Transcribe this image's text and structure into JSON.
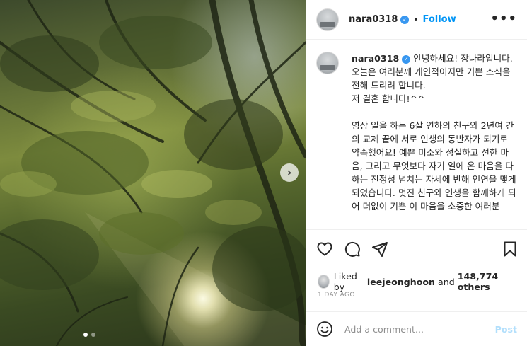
{
  "post": {
    "author": "nara0318",
    "follow_label": "Follow",
    "separator": "•",
    "more_label": "•••",
    "caption": {
      "username": "nara0318",
      "paragraph1": "안녕하세요! 장나라입니다.\n오늘은 여러분께 개인적이지만 기쁜 소식을 전해 드리려 합니다.\n저 결혼 합니다!^^",
      "paragraph2": "영상 일을 하는 6살 연하의 친구와 2년여 간의 교제 끝에 서로 인생의 동반자가 되기로 약속했어요! 예쁜 미소와 성실하고 선한 마음, 그리고 무엇보다 자기 일에 온 마음을 다하는 진정성 넘치는 자세에 반해 인연을 맺게 되었습니다. 멋진 친구와 인생을 함께하게 되어 더없이 기쁜 이 마음을 소중한 여러분"
    },
    "likes": {
      "prefix": "Liked by",
      "liked_by_user": "leejeonghoon",
      "and_label": "and",
      "others_label": "148,774 others"
    },
    "timestamp": "1 day ago",
    "comment": {
      "placeholder": "Add a comment...",
      "post_label": "Post"
    }
  },
  "media": {
    "next_arrow": "›",
    "carousel_dots": 2,
    "active_dot": 0
  },
  "icons": {
    "verified": "verified-badge-icon",
    "like": "heart-icon",
    "comment": "comment-icon",
    "share": "share-icon",
    "save": "bookmark-icon",
    "emoji": "emoji-icon"
  },
  "colors": {
    "accent": "#0095f6",
    "verified": "#3897f0",
    "muted": "#8e8e8e",
    "post_disabled": "#b2dffc"
  }
}
